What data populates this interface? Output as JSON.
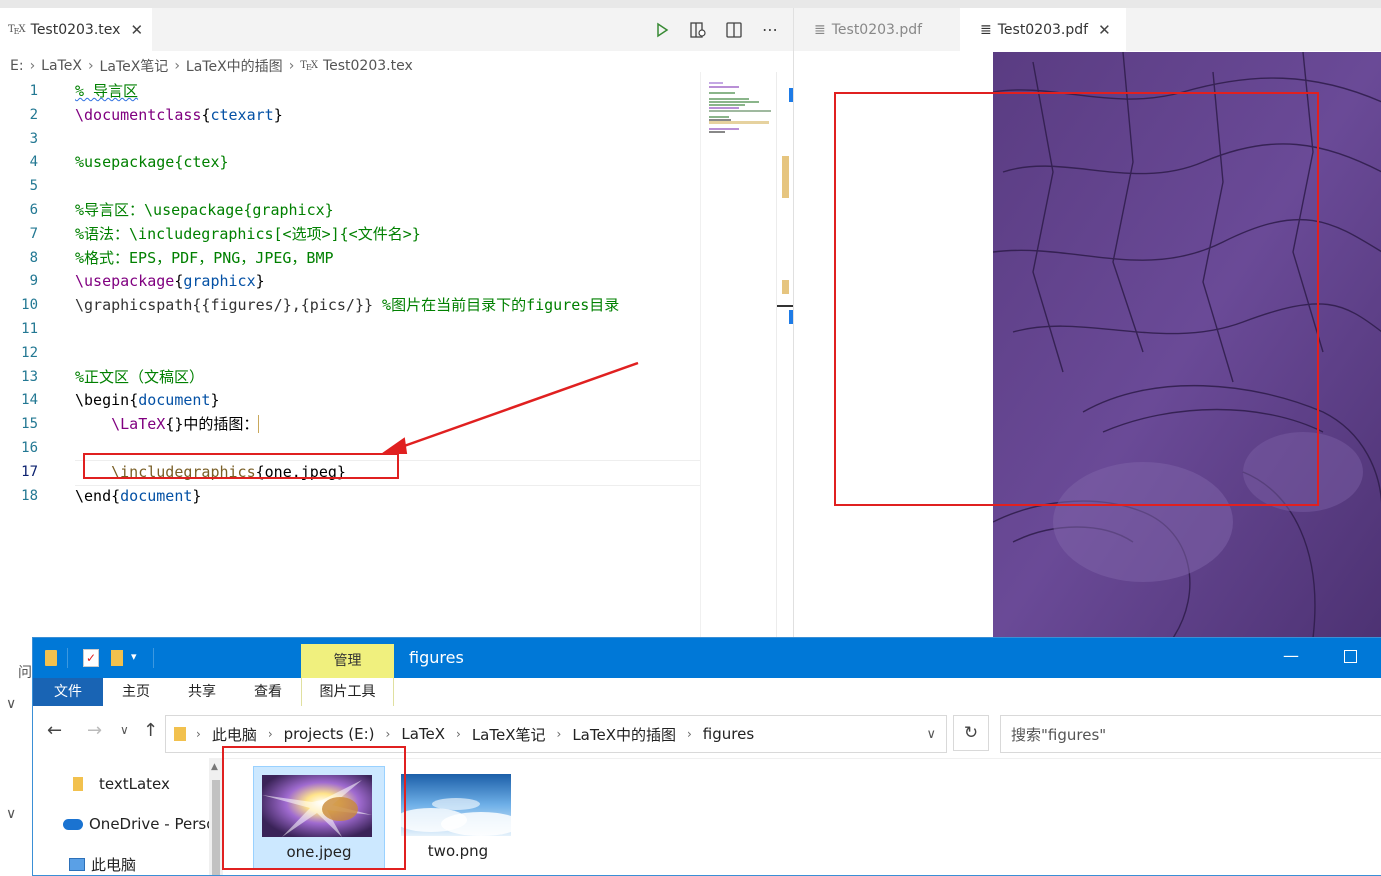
{
  "editor": {
    "tab_title": "Test0203.tex",
    "tab_icon_text": "TEX",
    "breadcrumb": [
      "E:",
      "LaTeX",
      "LaTeX笔记",
      "LaTeX中的插图",
      "Test0203.tex"
    ],
    "line_numbers": [
      "1",
      "2",
      "3",
      "4",
      "5",
      "6",
      "7",
      "8",
      "9",
      "10",
      "11",
      "12",
      "13",
      "14",
      "15",
      "16",
      "17",
      "18"
    ],
    "lines": {
      "l1": "% 导言区",
      "l2_cmd": "\\documentclass",
      "l2_arg": "ctexart",
      "l4": "%usepackage{ctex}",
      "l6": "%导言区：\\usepackage{graphicx}",
      "l7": "%语法：\\includegraphics[<选项>]{<文件名>}",
      "l8": "%格式：EPS，PDF，PNG，JPEG，BMP",
      "l9_cmd": "\\usepackage",
      "l9_arg": "graphicx",
      "l10_code": "\\graphicspath{{figures/},{pics/}} ",
      "l10_cmt": "%图片在当前目录下的figures目录",
      "l13": "%正文区（文稿区）",
      "l14_cmd": "\\begin",
      "l14_arg": "document",
      "l15_cmd": "\\LaTeX",
      "l15_rest": "中的插图：",
      "l17_cmd": "\\includegraphics",
      "l17_arg": "one.jpeg",
      "l18_cmd": "\\end",
      "l18_arg": "document"
    }
  },
  "pdf": {
    "tabs": [
      "Test0203.pdf",
      "Test0203.pdf"
    ]
  },
  "explorer": {
    "ribbon_context_tab": "管理",
    "folder_title": "figures",
    "ribbon_tabs": [
      "文件",
      "主页",
      "共享",
      "查看",
      "图片工具"
    ],
    "address": [
      "此电脑",
      "projects (E:)",
      "LaTeX",
      "LaTeX笔记",
      "LaTeX中的插图",
      "figures"
    ],
    "search_placeholder": "搜索\"figures\"",
    "nav": [
      "textLatex",
      "OneDrive - Perso",
      "此电脑"
    ],
    "files": [
      "one.jpeg",
      "two.png"
    ],
    "panel_label": "问"
  },
  "colors": {
    "accent": "#0078d7",
    "annotation_red": "#e02020",
    "comment_green": "#008000",
    "keyword_purple": "#800080",
    "arg_blue": "#0451a5"
  }
}
